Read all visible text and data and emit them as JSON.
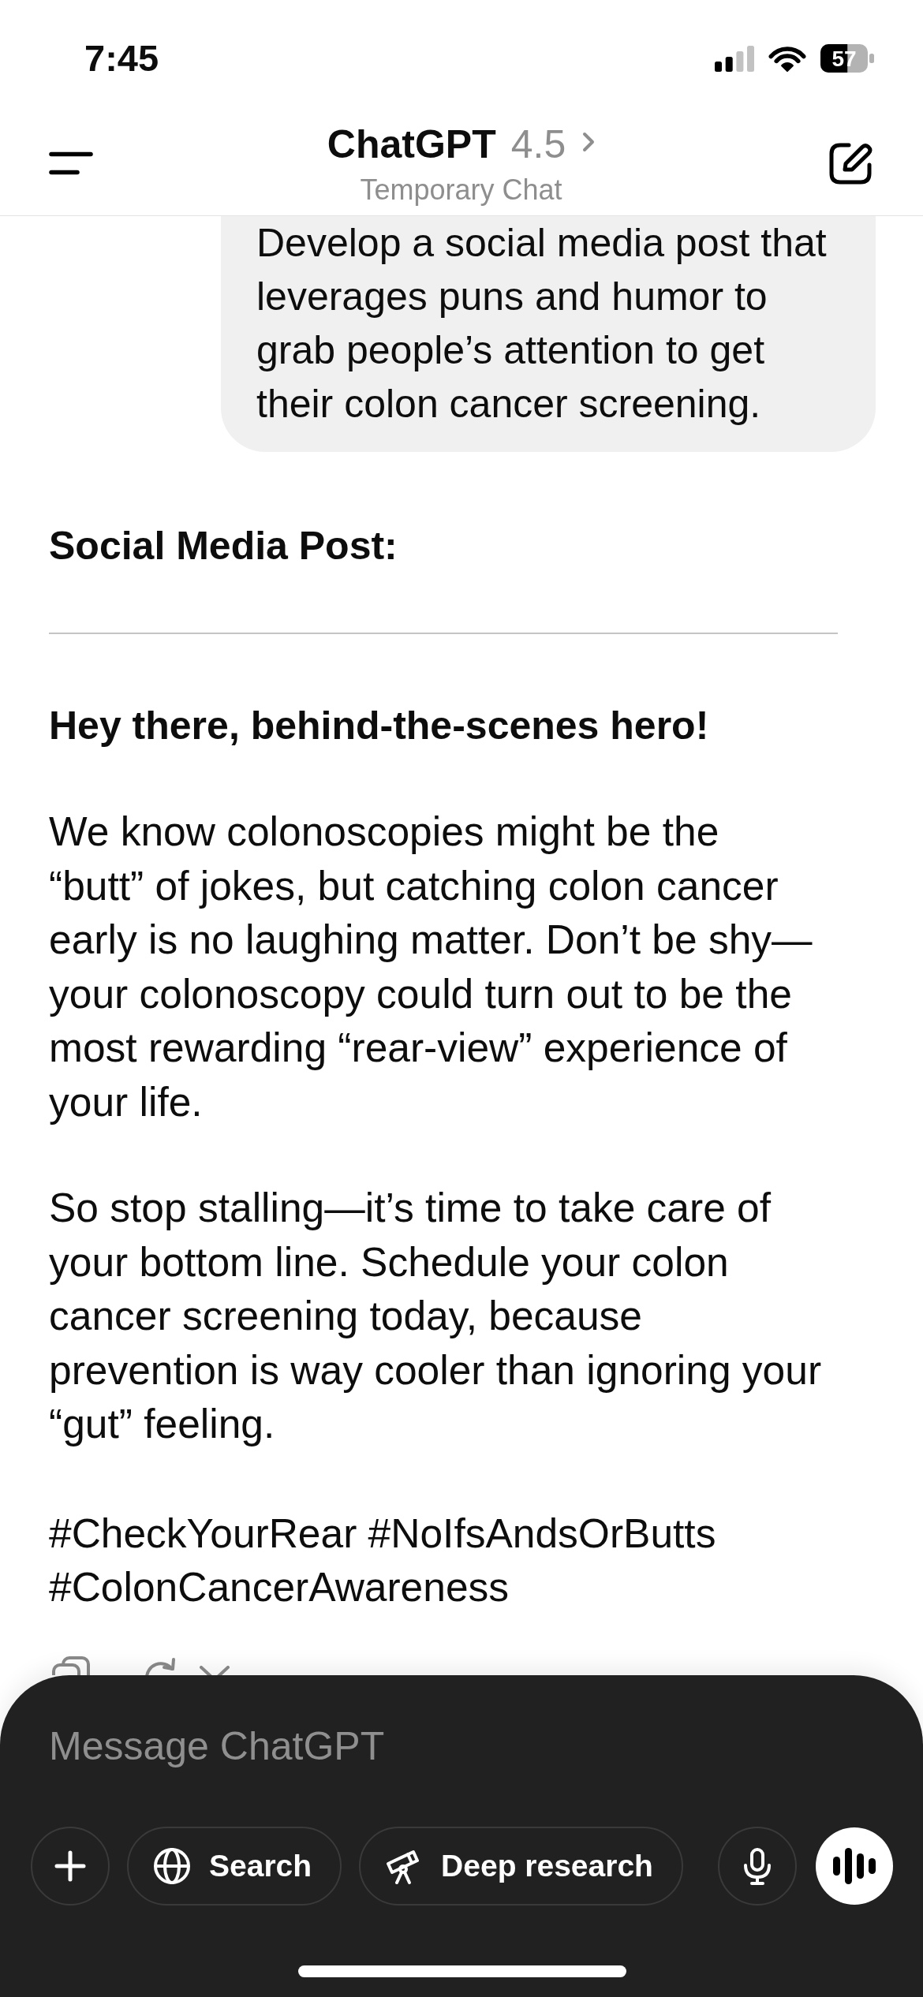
{
  "status_bar": {
    "time": "7:45",
    "battery": "57"
  },
  "header": {
    "title": "ChatGPT",
    "model": "4.5",
    "subtitle": "Temporary Chat"
  },
  "conversation": [
    {
      "kind": "user",
      "text": "Develop a social media post that leverages puns and humor to grab people’s attention to get their colon cancer screening."
    },
    {
      "kind": "assistant",
      "blocks": [
        {
          "kind": "heading",
          "text": "Social Media Post:"
        },
        {
          "kind": "rule"
        },
        {
          "kind": "heading",
          "text": "Hey there, behind-the-scenes hero!"
        },
        {
          "kind": "paragraph",
          "text": "We know colonoscopies might be the “butt” of jokes, but catching colon cancer early is no laughing matter. Don’t be shy—your colonoscopy could turn out to be the most rewarding “rear-view” experience of your life."
        },
        {
          "kind": "paragraph",
          "text": "So stop stalling—it’s time to take care of your bottom line. Schedule your colon cancer screening today, because prevention is way cooler than ignoring your “gut” feeling."
        },
        {
          "kind": "hashtags",
          "text": "#CheckYourRear #NoIfsAndsOrButts #ColonCancerAwareness"
        }
      ]
    }
  ],
  "composer": {
    "placeholder": "Message ChatGPT",
    "tools": [
      {
        "kind": "search",
        "label": "Search"
      },
      {
        "kind": "research",
        "label": "Deep research"
      }
    ]
  }
}
